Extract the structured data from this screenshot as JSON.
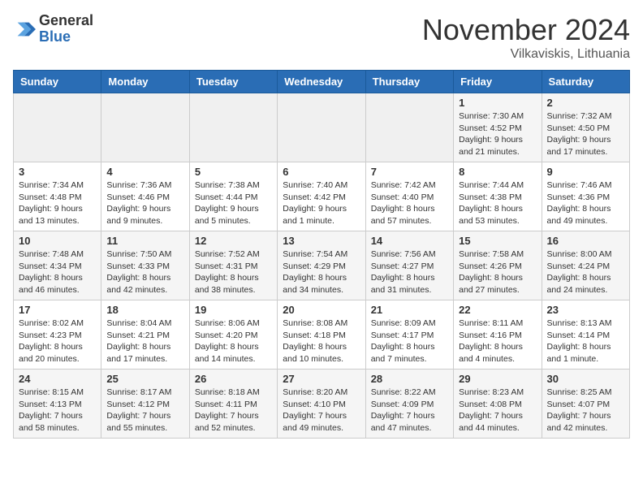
{
  "header": {
    "logo_general": "General",
    "logo_blue": "Blue",
    "month_title": "November 2024",
    "location": "Vilkaviskis, Lithuania"
  },
  "weekdays": [
    "Sunday",
    "Monday",
    "Tuesday",
    "Wednesday",
    "Thursday",
    "Friday",
    "Saturday"
  ],
  "weeks": [
    [
      {
        "day": "",
        "sunrise": "",
        "sunset": "",
        "daylight": ""
      },
      {
        "day": "",
        "sunrise": "",
        "sunset": "",
        "daylight": ""
      },
      {
        "day": "",
        "sunrise": "",
        "sunset": "",
        "daylight": ""
      },
      {
        "day": "",
        "sunrise": "",
        "sunset": "",
        "daylight": ""
      },
      {
        "day": "",
        "sunrise": "",
        "sunset": "",
        "daylight": ""
      },
      {
        "day": "1",
        "sunrise": "Sunrise: 7:30 AM",
        "sunset": "Sunset: 4:52 PM",
        "daylight": "Daylight: 9 hours and 21 minutes."
      },
      {
        "day": "2",
        "sunrise": "Sunrise: 7:32 AM",
        "sunset": "Sunset: 4:50 PM",
        "daylight": "Daylight: 9 hours and 17 minutes."
      }
    ],
    [
      {
        "day": "3",
        "sunrise": "Sunrise: 7:34 AM",
        "sunset": "Sunset: 4:48 PM",
        "daylight": "Daylight: 9 hours and 13 minutes."
      },
      {
        "day": "4",
        "sunrise": "Sunrise: 7:36 AM",
        "sunset": "Sunset: 4:46 PM",
        "daylight": "Daylight: 9 hours and 9 minutes."
      },
      {
        "day": "5",
        "sunrise": "Sunrise: 7:38 AM",
        "sunset": "Sunset: 4:44 PM",
        "daylight": "Daylight: 9 hours and 5 minutes."
      },
      {
        "day": "6",
        "sunrise": "Sunrise: 7:40 AM",
        "sunset": "Sunset: 4:42 PM",
        "daylight": "Daylight: 9 hours and 1 minute."
      },
      {
        "day": "7",
        "sunrise": "Sunrise: 7:42 AM",
        "sunset": "Sunset: 4:40 PM",
        "daylight": "Daylight: 8 hours and 57 minutes."
      },
      {
        "day": "8",
        "sunrise": "Sunrise: 7:44 AM",
        "sunset": "Sunset: 4:38 PM",
        "daylight": "Daylight: 8 hours and 53 minutes."
      },
      {
        "day": "9",
        "sunrise": "Sunrise: 7:46 AM",
        "sunset": "Sunset: 4:36 PM",
        "daylight": "Daylight: 8 hours and 49 minutes."
      }
    ],
    [
      {
        "day": "10",
        "sunrise": "Sunrise: 7:48 AM",
        "sunset": "Sunset: 4:34 PM",
        "daylight": "Daylight: 8 hours and 46 minutes."
      },
      {
        "day": "11",
        "sunrise": "Sunrise: 7:50 AM",
        "sunset": "Sunset: 4:33 PM",
        "daylight": "Daylight: 8 hours and 42 minutes."
      },
      {
        "day": "12",
        "sunrise": "Sunrise: 7:52 AM",
        "sunset": "Sunset: 4:31 PM",
        "daylight": "Daylight: 8 hours and 38 minutes."
      },
      {
        "day": "13",
        "sunrise": "Sunrise: 7:54 AM",
        "sunset": "Sunset: 4:29 PM",
        "daylight": "Daylight: 8 hours and 34 minutes."
      },
      {
        "day": "14",
        "sunrise": "Sunrise: 7:56 AM",
        "sunset": "Sunset: 4:27 PM",
        "daylight": "Daylight: 8 hours and 31 minutes."
      },
      {
        "day": "15",
        "sunrise": "Sunrise: 7:58 AM",
        "sunset": "Sunset: 4:26 PM",
        "daylight": "Daylight: 8 hours and 27 minutes."
      },
      {
        "day": "16",
        "sunrise": "Sunrise: 8:00 AM",
        "sunset": "Sunset: 4:24 PM",
        "daylight": "Daylight: 8 hours and 24 minutes."
      }
    ],
    [
      {
        "day": "17",
        "sunrise": "Sunrise: 8:02 AM",
        "sunset": "Sunset: 4:23 PM",
        "daylight": "Daylight: 8 hours and 20 minutes."
      },
      {
        "day": "18",
        "sunrise": "Sunrise: 8:04 AM",
        "sunset": "Sunset: 4:21 PM",
        "daylight": "Daylight: 8 hours and 17 minutes."
      },
      {
        "day": "19",
        "sunrise": "Sunrise: 8:06 AM",
        "sunset": "Sunset: 4:20 PM",
        "daylight": "Daylight: 8 hours and 14 minutes."
      },
      {
        "day": "20",
        "sunrise": "Sunrise: 8:08 AM",
        "sunset": "Sunset: 4:18 PM",
        "daylight": "Daylight: 8 hours and 10 minutes."
      },
      {
        "day": "21",
        "sunrise": "Sunrise: 8:09 AM",
        "sunset": "Sunset: 4:17 PM",
        "daylight": "Daylight: 8 hours and 7 minutes."
      },
      {
        "day": "22",
        "sunrise": "Sunrise: 8:11 AM",
        "sunset": "Sunset: 4:16 PM",
        "daylight": "Daylight: 8 hours and 4 minutes."
      },
      {
        "day": "23",
        "sunrise": "Sunrise: 8:13 AM",
        "sunset": "Sunset: 4:14 PM",
        "daylight": "Daylight: 8 hours and 1 minute."
      }
    ],
    [
      {
        "day": "24",
        "sunrise": "Sunrise: 8:15 AM",
        "sunset": "Sunset: 4:13 PM",
        "daylight": "Daylight: 7 hours and 58 minutes."
      },
      {
        "day": "25",
        "sunrise": "Sunrise: 8:17 AM",
        "sunset": "Sunset: 4:12 PM",
        "daylight": "Daylight: 7 hours and 55 minutes."
      },
      {
        "day": "26",
        "sunrise": "Sunrise: 8:18 AM",
        "sunset": "Sunset: 4:11 PM",
        "daylight": "Daylight: 7 hours and 52 minutes."
      },
      {
        "day": "27",
        "sunrise": "Sunrise: 8:20 AM",
        "sunset": "Sunset: 4:10 PM",
        "daylight": "Daylight: 7 hours and 49 minutes."
      },
      {
        "day": "28",
        "sunrise": "Sunrise: 8:22 AM",
        "sunset": "Sunset: 4:09 PM",
        "daylight": "Daylight: 7 hours and 47 minutes."
      },
      {
        "day": "29",
        "sunrise": "Sunrise: 8:23 AM",
        "sunset": "Sunset: 4:08 PM",
        "daylight": "Daylight: 7 hours and 44 minutes."
      },
      {
        "day": "30",
        "sunrise": "Sunrise: 8:25 AM",
        "sunset": "Sunset: 4:07 PM",
        "daylight": "Daylight: 7 hours and 42 minutes."
      }
    ]
  ]
}
